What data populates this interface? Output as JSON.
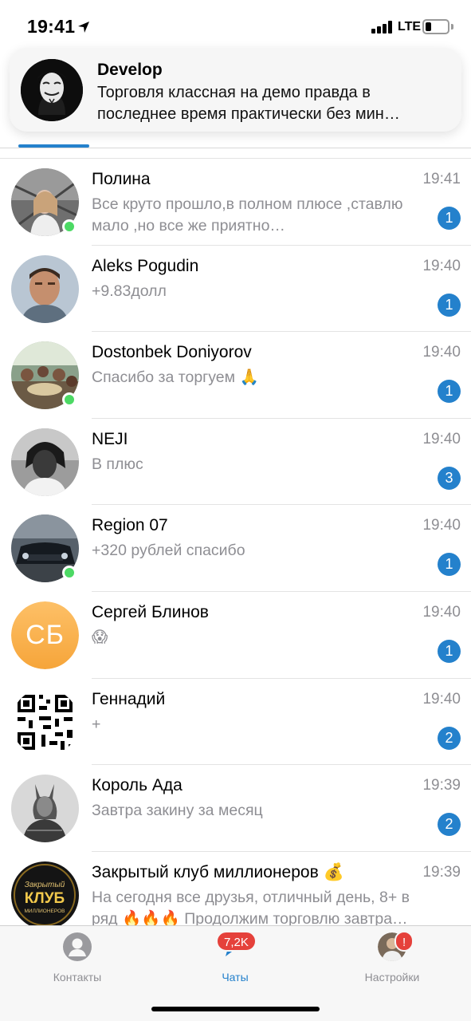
{
  "status_bar": {
    "time": "19:41",
    "network": "LTE"
  },
  "notification": {
    "title": "Develop",
    "body": "Торговля классная на демо правда в последнее время практически без мин…"
  },
  "chats": [
    {
      "name": "Полина",
      "time": "19:41",
      "message": "Все круто прошло,в полном плюсе ,ставлю мало ,но все же приятно…",
      "unread": "1",
      "online": true
    },
    {
      "name": "Aleks Pogudin",
      "time": "19:40",
      "message": "+9.83долл",
      "unread": "1",
      "online": false
    },
    {
      "name": "Dostonbek Doniyorov",
      "time": "19:40",
      "message": "Спасибо за торгуем 🙏",
      "unread": "1",
      "online": true
    },
    {
      "name": "NEJI",
      "time": "19:40",
      "message": "В плюс",
      "unread": "3",
      "online": false
    },
    {
      "name": "Region 07",
      "time": "19:40",
      "message": "+320 рублей спасибо",
      "unread": "1",
      "online": true
    },
    {
      "name": "Сергей Блинов",
      "initials": "СБ",
      "time": "19:40",
      "message": "😱",
      "unread": "1",
      "online": false
    },
    {
      "name": "Геннадий",
      "time": "19:40",
      "message": "+",
      "unread": "2",
      "online": false
    },
    {
      "name": "Король Ада",
      "time": "19:39",
      "message": "Завтра закину за месяц",
      "unread": "2",
      "online": false
    },
    {
      "name": "Закрытый клуб миллионеров 💰",
      "avatar_text": [
        "Закрытый",
        "КЛУБ",
        "МИЛЛИОНЕРОВ"
      ],
      "time": "19:39",
      "message": "На сегодня все друзья, отличный день, 8+ в ряд 🔥🔥🔥 Продолжим торговлю завтра…",
      "unread": "",
      "online": false
    }
  ],
  "tab_bar": {
    "contacts_label": "Контакты",
    "chats_label": "Чаты",
    "chats_badge": "7,2K",
    "settings_label": "Настройки",
    "settings_badge": "!"
  },
  "colors": {
    "accent": "#2481cc",
    "online": "#4cd964",
    "badge_red": "#e5413b"
  }
}
